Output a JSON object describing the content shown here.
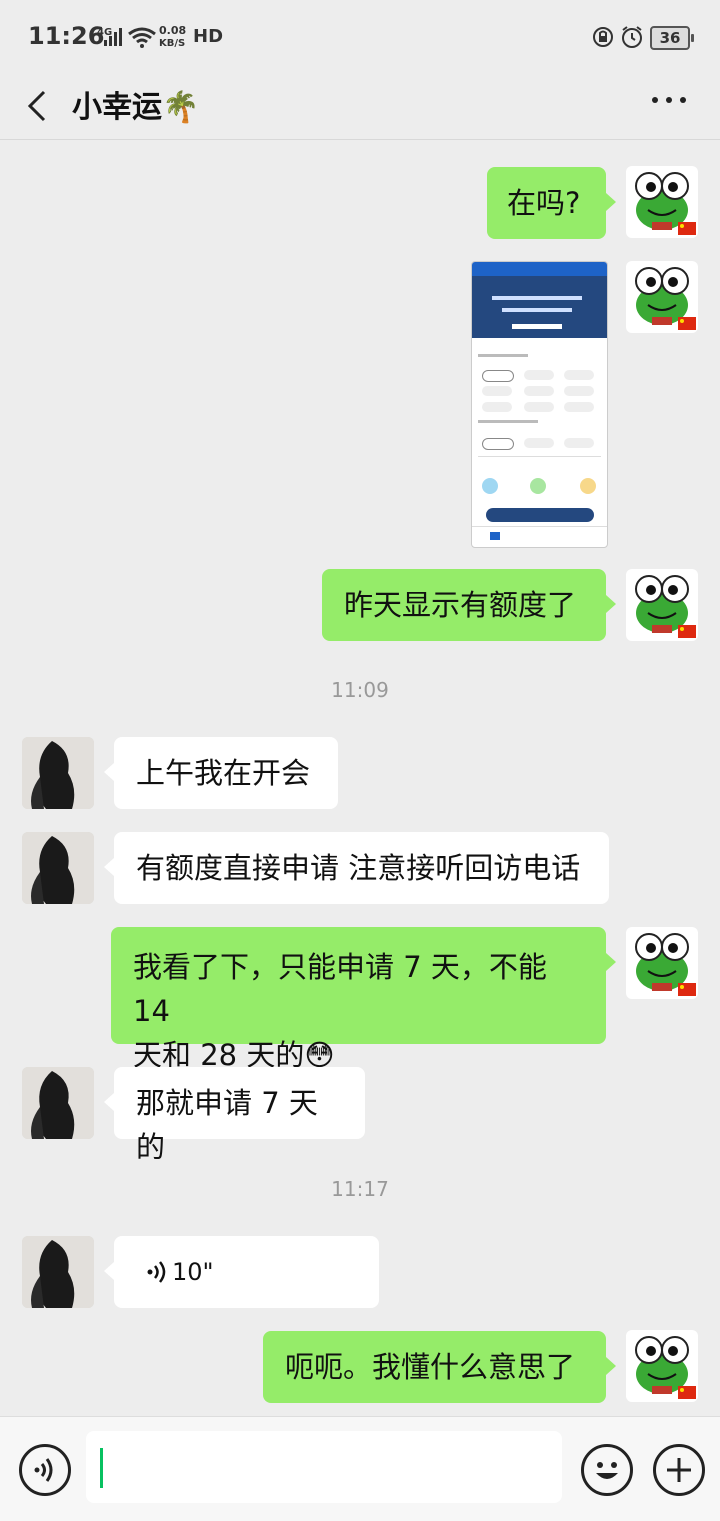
{
  "status": {
    "time": "11:26",
    "network": "4G",
    "speed_value": "0.08",
    "speed_unit": "KB/S",
    "hd": "HD",
    "battery": "36"
  },
  "header": {
    "title": "小幸运🌴"
  },
  "messages": [
    {
      "from": "me",
      "text": "在吗?"
    },
    {
      "from": "me",
      "type": "image"
    },
    {
      "from": "me",
      "text": "昨天显示有额度了"
    },
    {
      "from": "them",
      "text": "上午我在开会"
    },
    {
      "from": "them",
      "text": "有额度直接申请 注意接听回访电话"
    },
    {
      "from": "me",
      "line1": "我看了下，只能申请 7 天，不能 14",
      "line2": "天和 28 天的😳"
    },
    {
      "from": "them",
      "text": "那就申请 7 天的"
    },
    {
      "from": "them",
      "type": "voice",
      "duration": "10\""
    },
    {
      "from": "me",
      "text": "呃呃。我懂什么意思了"
    }
  ],
  "timestamps": [
    "11:09",
    "11:17"
  ],
  "colors": {
    "my_bubble": "#95ec69",
    "their_bubble": "#ffffff",
    "background": "#ededed",
    "caret": "#07c160"
  },
  "icons": {
    "back": "chevron-left-icon",
    "more": "more-dots-icon",
    "voice": "voice-input-icon",
    "emoji": "emoji-icon",
    "add": "plus-icon"
  }
}
